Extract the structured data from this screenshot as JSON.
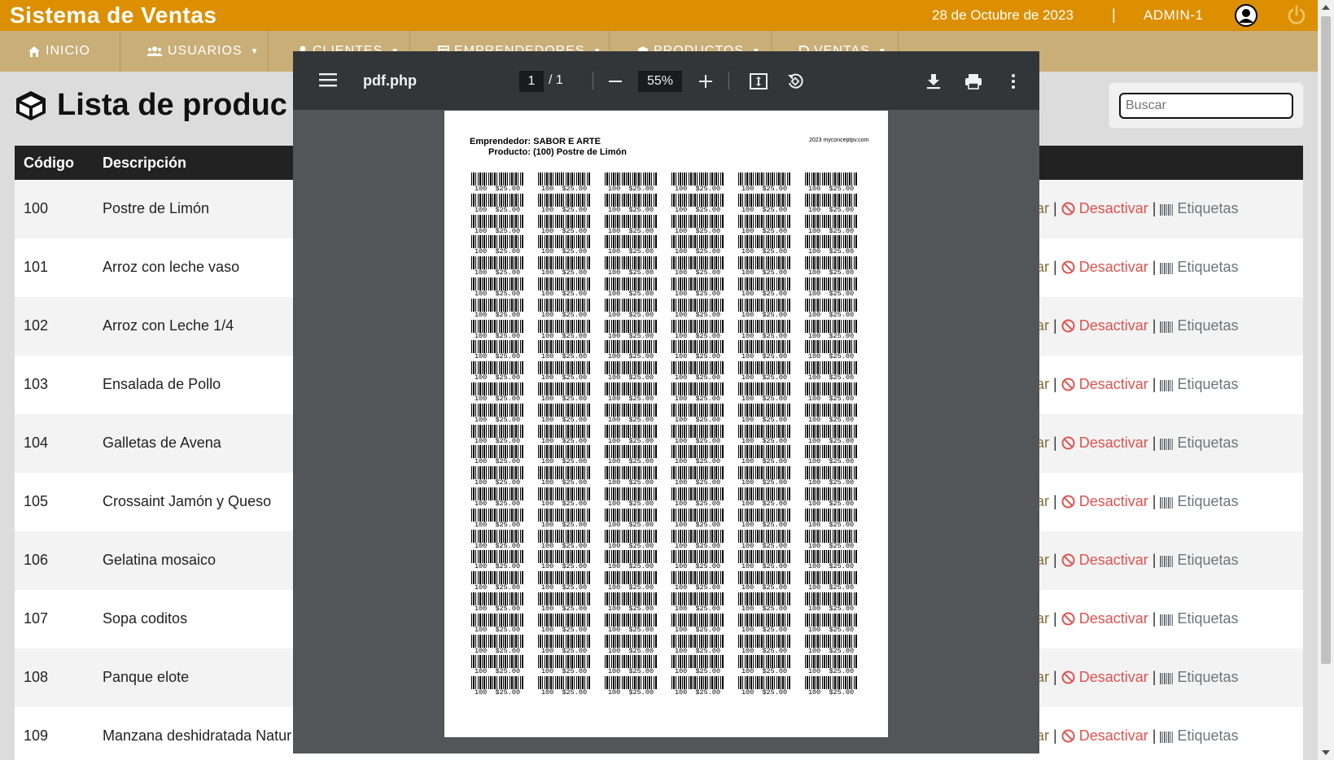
{
  "header": {
    "brand": "Sistema de Ventas",
    "date": "28 de Octubre de 2023",
    "separator": "|",
    "user": "ADMIN-1"
  },
  "nav": {
    "items": [
      {
        "label": "INICIO",
        "icon": "home-icon"
      },
      {
        "label": "USUARIOS",
        "icon": "users-icon"
      },
      {
        "label": "CLIENTES",
        "icon": "user-icon"
      },
      {
        "label": "EMPRENDEDORES",
        "icon": "store-icon"
      },
      {
        "label": "PRODUCTOS",
        "icon": "box-icon"
      },
      {
        "label": "VENTAS",
        "icon": "file-icon"
      }
    ]
  },
  "page": {
    "title": "Lista de produc",
    "search_placeholder": "Buscar"
  },
  "table": {
    "headers": [
      "Código",
      "Descripción"
    ],
    "action_edit": "ar",
    "action_sep": " | ",
    "action_deactivate": "Desactivar",
    "action_labels": "Etiquetas",
    "rows": [
      {
        "code": "100",
        "desc": "Postre de Limón"
      },
      {
        "code": "101",
        "desc": "Arroz con leche vaso"
      },
      {
        "code": "102",
        "desc": "Arroz con Leche 1/4"
      },
      {
        "code": "103",
        "desc": "Ensalada de Pollo"
      },
      {
        "code": "104",
        "desc": "Galletas de Avena"
      },
      {
        "code": "105",
        "desc": "Crossaint Jamón y Queso"
      },
      {
        "code": "106",
        "desc": "Gelatina mosaico"
      },
      {
        "code": "107",
        "desc": "Sopa coditos"
      },
      {
        "code": "108",
        "desc": "Panque elote"
      },
      {
        "code": "109",
        "desc": "Manzana deshidratada Natur"
      }
    ]
  },
  "pdf_viewer": {
    "filename": "pdf.php",
    "page_current": "1",
    "page_total": "/ 1",
    "zoom": "55%",
    "doc": {
      "line1": "Emprendedor: SABOR E ARTE",
      "line2": "Producto: (100) Postre de Limón",
      "site": "2023 myconceptpv.com",
      "label_text": "100  $25.00",
      "columns": 6,
      "rows": 25
    }
  },
  "colors": {
    "header_bg": "#dc8f00",
    "nav_bg": "#c9ae78",
    "deactivate": "#e0524f",
    "viewer_toolbar": "#323639",
    "viewer_bg": "#525659"
  }
}
